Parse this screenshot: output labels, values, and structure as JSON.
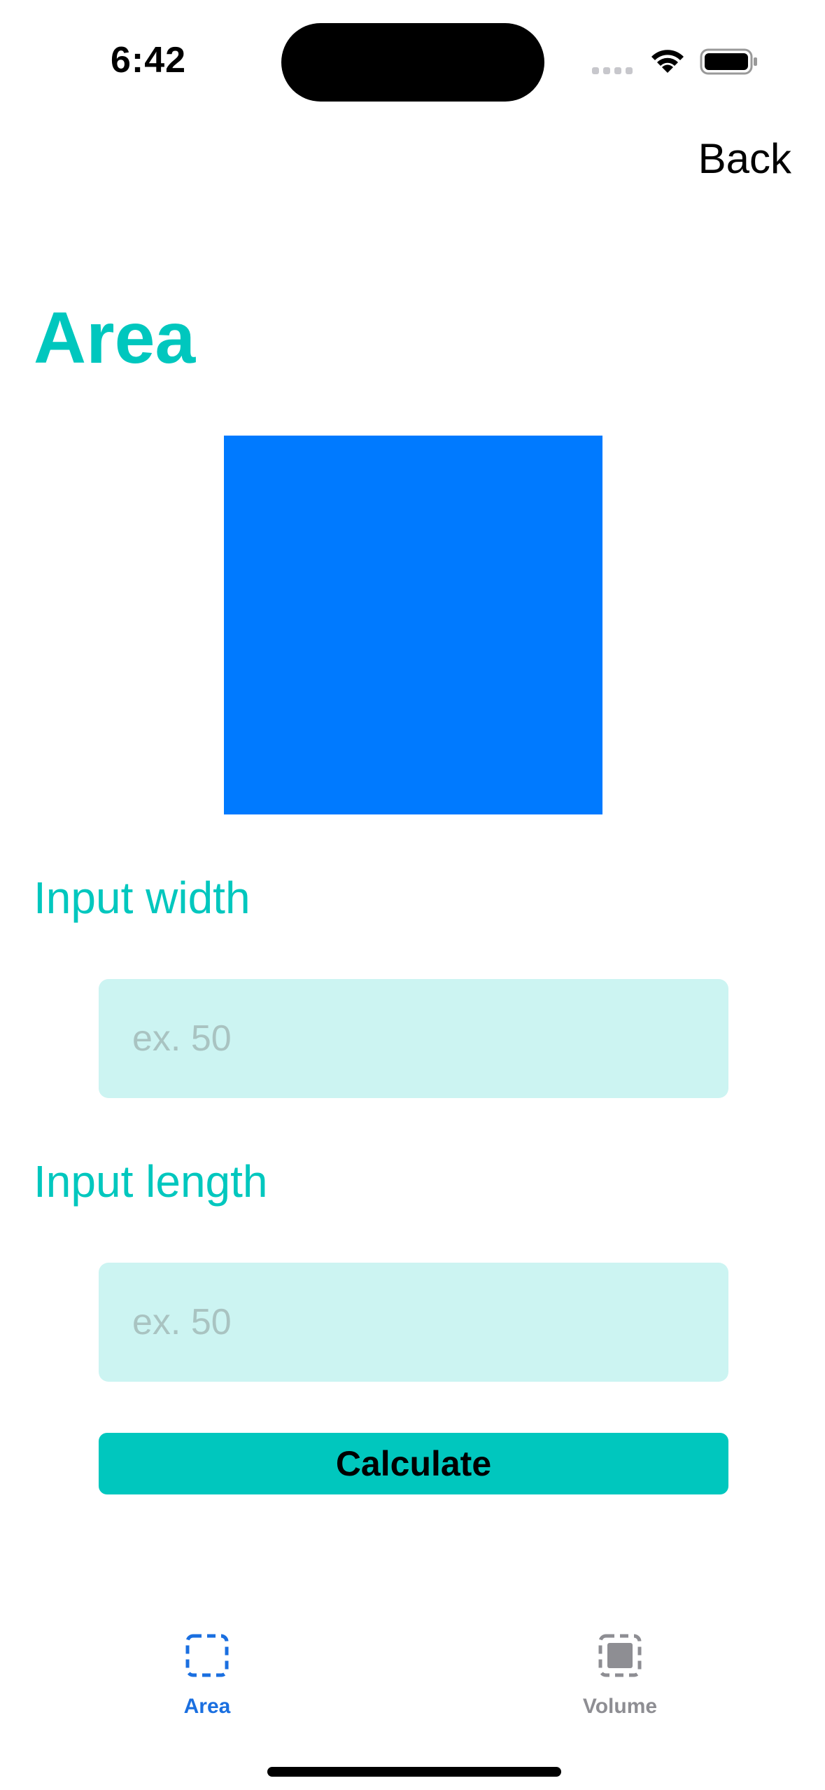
{
  "status_bar": {
    "time": "6:42"
  },
  "nav": {
    "back_label": "Back"
  },
  "page": {
    "title": "Area",
    "shape_color": "#007aff",
    "accent_color": "#00c7be"
  },
  "form": {
    "width_label": "Input width",
    "width_placeholder": "ex. 50",
    "width_value": "",
    "length_label": "Input length",
    "length_placeholder": "ex. 50",
    "length_value": "",
    "calculate_label": "Calculate"
  },
  "tab_bar": {
    "tabs": [
      {
        "label": "Area",
        "icon": "dashed-square-icon",
        "selected": true
      },
      {
        "label": "Volume",
        "icon": "filled-dashed-square-icon",
        "selected": false
      }
    ]
  }
}
